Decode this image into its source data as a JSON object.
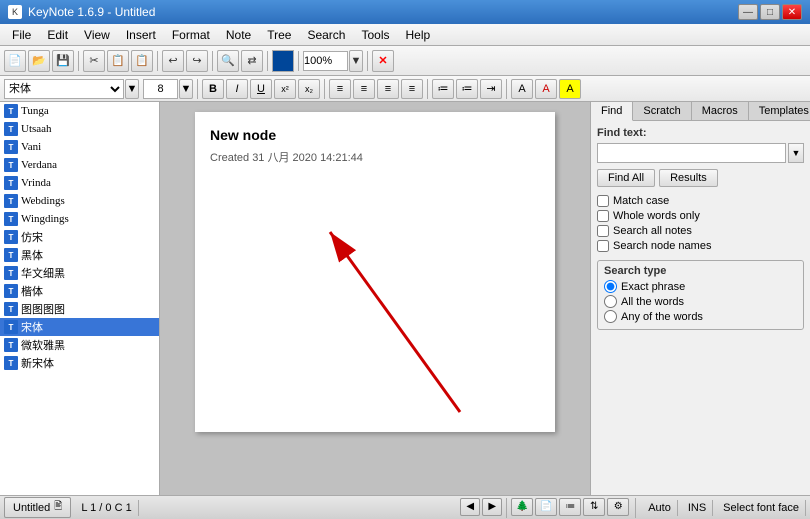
{
  "titlebar": {
    "title": "KeyNote 1.6.9 - Untitled",
    "min_btn": "—",
    "max_btn": "□",
    "close_btn": "✕"
  },
  "menubar": {
    "items": [
      "File",
      "Edit",
      "View",
      "Insert",
      "Format",
      "Note",
      "Tree",
      "Search",
      "Tools",
      "Help"
    ]
  },
  "toolbar": {
    "buttons": [
      "📄",
      "📂",
      "💾",
      "✂",
      "📋",
      "↩",
      "↪",
      "▩",
      "🔍",
      "100%"
    ]
  },
  "formatbar": {
    "font": "宋体",
    "size": "8",
    "bold": "B",
    "italic": "I",
    "underline": "U",
    "superscript": "x²",
    "subscript": "x₂"
  },
  "fontlist": {
    "fonts": [
      "Tunga",
      "Utsaah",
      "Vani",
      "Verdana",
      "Vrinda",
      "Webdings",
      "Wingdings",
      "仿宋",
      "黑体",
      "华文细黑",
      "楷体",
      "图图图图",
      "宋体",
      "微软雅黑",
      "新宋体"
    ],
    "selected_index": 12
  },
  "editor": {
    "node_title": "New node",
    "node_date": "Created 31 八月 2020 14:21:44"
  },
  "find_panel": {
    "tabs": [
      "Find",
      "Scratch",
      "Macros",
      "Templates"
    ],
    "active_tab": "Find",
    "find_label": "Find text:",
    "find_placeholder": "",
    "find_all_btn": "Find All",
    "results_btn": "Results",
    "options": {
      "match_case": "Match case",
      "whole_words": "Whole words only",
      "search_notes": "Search all notes",
      "search_nodes": "Search node names"
    },
    "search_type": {
      "label": "Search type",
      "options": [
        "Exact phrase",
        "All the words",
        "Any of the words"
      ],
      "selected": "Exact phrase"
    }
  },
  "statusbar": {
    "tab_label": "Untitled",
    "position": "L 1 / 0  C 1",
    "mode": "Auto",
    "ins": "INS",
    "status_text": "Select font face"
  }
}
